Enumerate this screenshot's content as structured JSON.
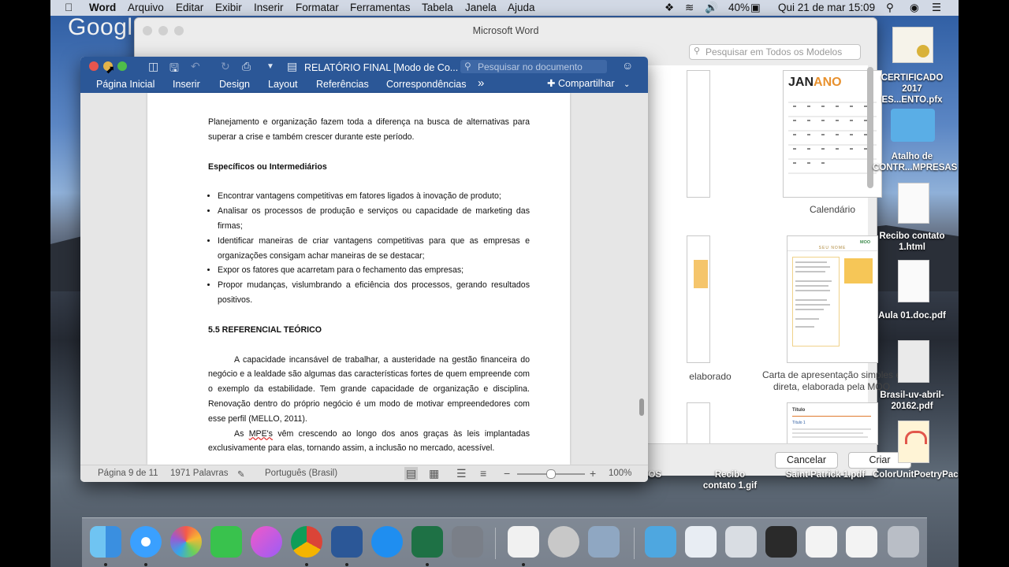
{
  "menubar": {
    "apple": "",
    "app_name": "Word",
    "items": [
      "Arquivo",
      "Editar",
      "Exibir",
      "Inserir",
      "Formatar",
      "Ferramentas",
      "Tabela",
      "Janela",
      "Ajuda"
    ],
    "battery": "40%",
    "clock": "Qui 21 de mar  15:09"
  },
  "desktop_bg_text": "Googl",
  "gallery": {
    "title": "Microsoft Word",
    "search_placeholder": "Pesquisar em Todos os Modelos",
    "calendar_title_a": "JAN",
    "calendar_title_b": "ANO",
    "calendar_label": "Calendário",
    "moo_label": "Carta de apresentação simples e direta, elaborada pela MOO",
    "moo_name": "SEU NOME",
    "moo_brand": "MOO",
    "partial_label": "elaborado",
    "title_doc_head": "Título",
    "title_doc_sub": "Título 1",
    "cancel": "Cancelar",
    "create": "Criar"
  },
  "word": {
    "title": "RELATÓRIO FINAL [Modo de Co...",
    "search_placeholder": "Pesquisar no documento",
    "tabs": [
      "Página Inicial",
      "Inserir",
      "Design",
      "Layout",
      "Referências",
      "Correspondências"
    ],
    "more_tabs": "»",
    "share": "Compartilhar",
    "doc": {
      "p1": "Planejamento e organização fazem toda a diferença na busca de alternativas para superar a crise e também crescer durante este período.",
      "h1": "Específicos ou Intermediários",
      "bullets": [
        "Encontrar vantagens competitivas em fatores ligados à inovação de produto;",
        "Analisar os processos de produção e serviços ou capacidade de marketing das firmas;",
        "Identificar maneiras de criar vantagens competitivas para que as empresas e organizações consigam achar maneiras de se destacar;",
        "Expor os fatores que acarretam para o fechamento das empresas;",
        "Propor mudanças, vislumbrando a eficiência dos processos, gerando resultados positivos."
      ],
      "h2": "5.5 REFERENCIAL TEÓRICO",
      "p2": "A capacidade incansável de trabalhar, a austeridade na gestão financeira do negócio e a lealdade são algumas das características fortes de quem empreende com o exemplo da estabilidade. Tem grande capacidade de organização e disciplina. Renovação dentro do próprio negócio é um modo de motivar empreendedores com esse perfil (MELLO, 2011).",
      "p3_a": "As ",
      "p3_mpe": "MPE's",
      "p3_b": " vêm crescendo ao longo dos anos graças às leis implantadas exclusivamente para elas, tornando assim, a inclusão no mercado, acessível."
    },
    "status": {
      "page": "Página 9 de 11",
      "words": "1971 Palavras",
      "language": "Português (Brasil)",
      "zoom": "100%",
      "zoom_minus": "−",
      "zoom_plus": "+"
    }
  },
  "desktop_icons": [
    {
      "label": "CERTIFICADO 2017 ES...ENTO.pfx"
    },
    {
      "label": "Atalho de CONTR...MPRESAS"
    },
    {
      "label": "Recibo contato 1.html"
    },
    {
      "label": "Aula 01.doc.pdf"
    },
    {
      "label": "Brasil-uv-abril-20162.pdf"
    },
    {
      "label": "ColorUnitPoetryPackage.pdf"
    }
  ],
  "behind_labels": {
    "recibo_gif": "Recibo contato 1.gif",
    "saint": "Saint Patrick 1.pdf",
    "etos": "ETOS"
  },
  "dock_apps": [
    "finder",
    "safari",
    "photos",
    "facetime",
    "itunes",
    "chrome",
    "word",
    "app-store",
    "excel",
    "system-preferences",
    "preview",
    "keychain",
    "image-capture",
    "downloads",
    "documents",
    "chrome-window",
    "word-doc",
    "word-doc-2",
    "trash"
  ]
}
